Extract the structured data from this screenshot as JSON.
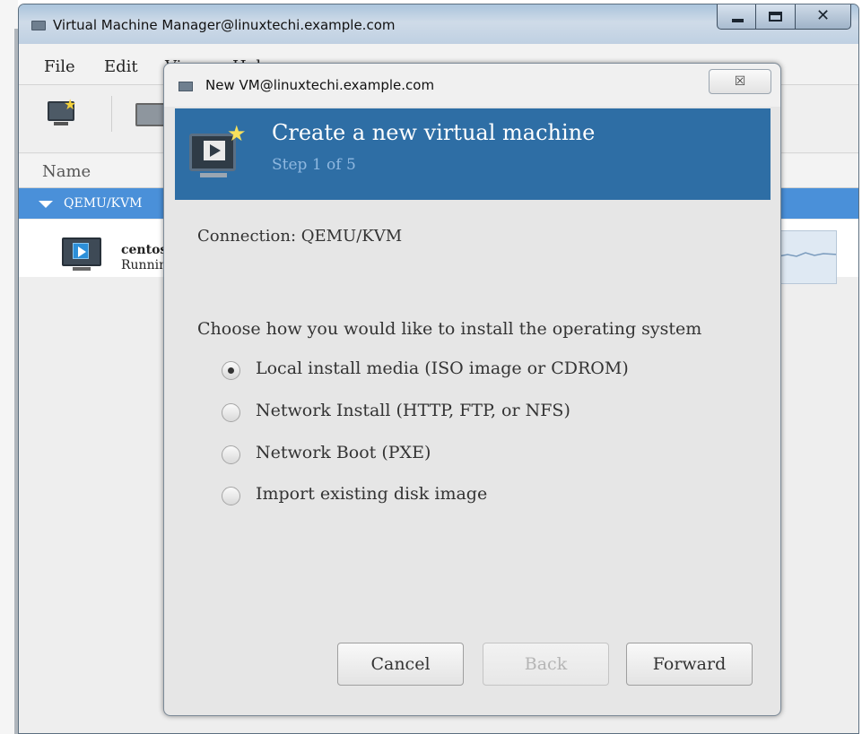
{
  "main_window": {
    "title": "Virtual Machine Manager@linuxtechi.example.com",
    "menu": [
      "File",
      "Edit",
      "View",
      "Help"
    ],
    "list_header": "Name",
    "group": "QEMU/KVM",
    "vm": {
      "name": "centos",
      "status": "Running"
    }
  },
  "dialog": {
    "title": "New VM@linuxtechi.example.com",
    "close_glyph": "☒",
    "header": {
      "title": "Create a new virtual machine",
      "step": "Step 1 of 5"
    },
    "connection_label": "Connection:  QEMU/KVM",
    "install_prompt": "Choose how you would like to install the operating system",
    "install_options": [
      {
        "label": "Local install media (ISO image or CDROM)",
        "selected": true
      },
      {
        "label": "Network Install (HTTP, FTP, or NFS)",
        "selected": false
      },
      {
        "label": "Network Boot (PXE)",
        "selected": false
      },
      {
        "label": "Import existing disk image",
        "selected": false
      }
    ],
    "buttons": {
      "cancel": "Cancel",
      "back": "Back",
      "forward": "Forward"
    }
  },
  "colors": {
    "wizard_banner": "#2e6ea5",
    "selection_blue": "#4a90d9"
  }
}
